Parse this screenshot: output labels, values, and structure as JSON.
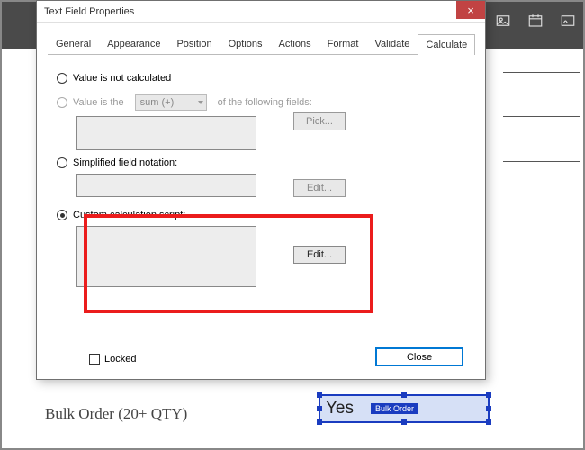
{
  "dialog": {
    "title": "Text Field Properties",
    "close_x": "×",
    "tabs": [
      "General",
      "Appearance",
      "Position",
      "Options",
      "Actions",
      "Format",
      "Validate",
      "Calculate"
    ],
    "active_tab_index": 7,
    "radio_not_calculated": "Value is not calculated",
    "radio_value_is_the": "Value is the",
    "dropdown_sum": "sum (+)",
    "of_following": "of the following fields:",
    "btn_pick": "Pick...",
    "radio_simplified": "Simplified field notation:",
    "btn_edit1": "Edit...",
    "radio_custom": "Custom calculation script:",
    "btn_edit2": "Edit...",
    "locked_label": "Locked",
    "close_btn": "Close"
  },
  "doc": {
    "bulk_label": "Bulk Order (20+ QTY)",
    "field_value": "Yes",
    "field_name": "Bulk Order"
  }
}
